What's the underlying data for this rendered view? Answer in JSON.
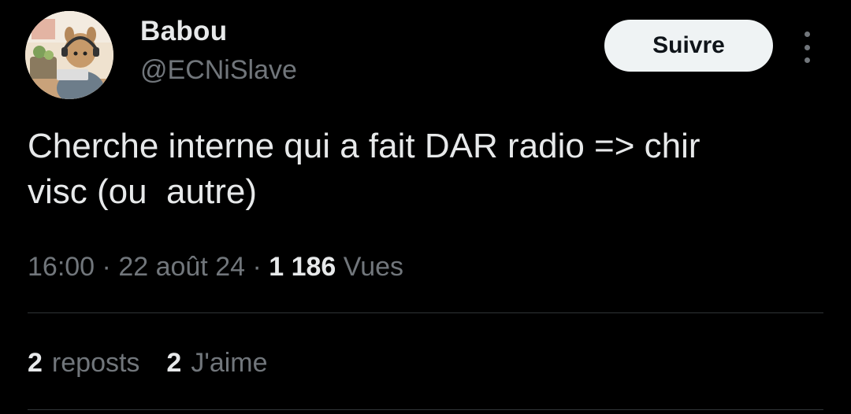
{
  "author": {
    "name": "Babou",
    "handle": "@ECNiSlave",
    "avatar_icon": "avatar-illustration-icon"
  },
  "follow_button": {
    "label": "Suivre"
  },
  "more_menu": {
    "icon": "more-vertical-icon"
  },
  "tweet": {
    "text": "Cherche interne qui a fait DAR radio => chir\nvisc (ou  autre)"
  },
  "meta": {
    "time": "16:00",
    "separator": " · ",
    "date": "22 août 24",
    "views_count": "1 186",
    "views_label": "Vues"
  },
  "stats": {
    "reposts_count": "2",
    "reposts_label": "reposts",
    "likes_count": "2",
    "likes_label": "J'aime"
  },
  "colors": {
    "background": "#000000",
    "primary_text": "#e7e9ea",
    "secondary_text": "#71767b",
    "button_bg": "#eff3f4",
    "divider": "#2f3336"
  }
}
